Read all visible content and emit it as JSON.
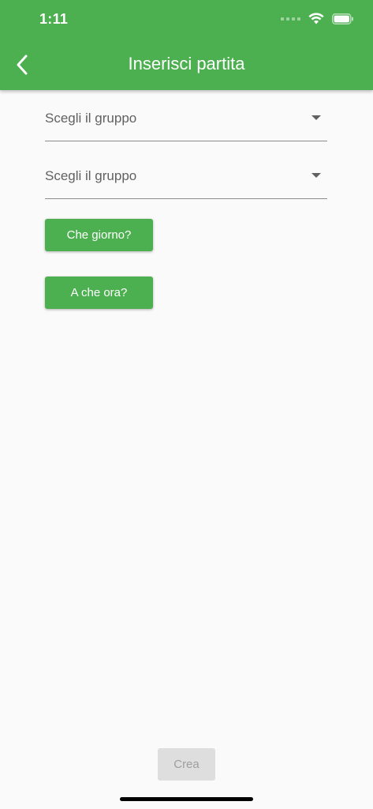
{
  "status_bar": {
    "time": "1:11",
    "icons": [
      "cellular-signal-icon",
      "wifi-icon",
      "battery-icon"
    ]
  },
  "app_bar": {
    "title": "Inserisci partita",
    "back_icon": "chevron-left-icon",
    "color": "#4caf50"
  },
  "form": {
    "group_select_1": {
      "label": "Scegli il gruppo",
      "caret_icon": "caret-down-icon"
    },
    "group_select_2": {
      "label": "Scegli il gruppo",
      "caret_icon": "caret-down-icon"
    },
    "date_button": {
      "label": "Che giorno?"
    },
    "time_button": {
      "label": "A che ora?"
    }
  },
  "footer": {
    "create_button": {
      "label": "Crea",
      "state": "disabled"
    }
  },
  "colors": {
    "accent": "#4caf50",
    "background": "#fafafa",
    "disabled_bg": "#dedede",
    "disabled_text": "#9e9e9e"
  }
}
